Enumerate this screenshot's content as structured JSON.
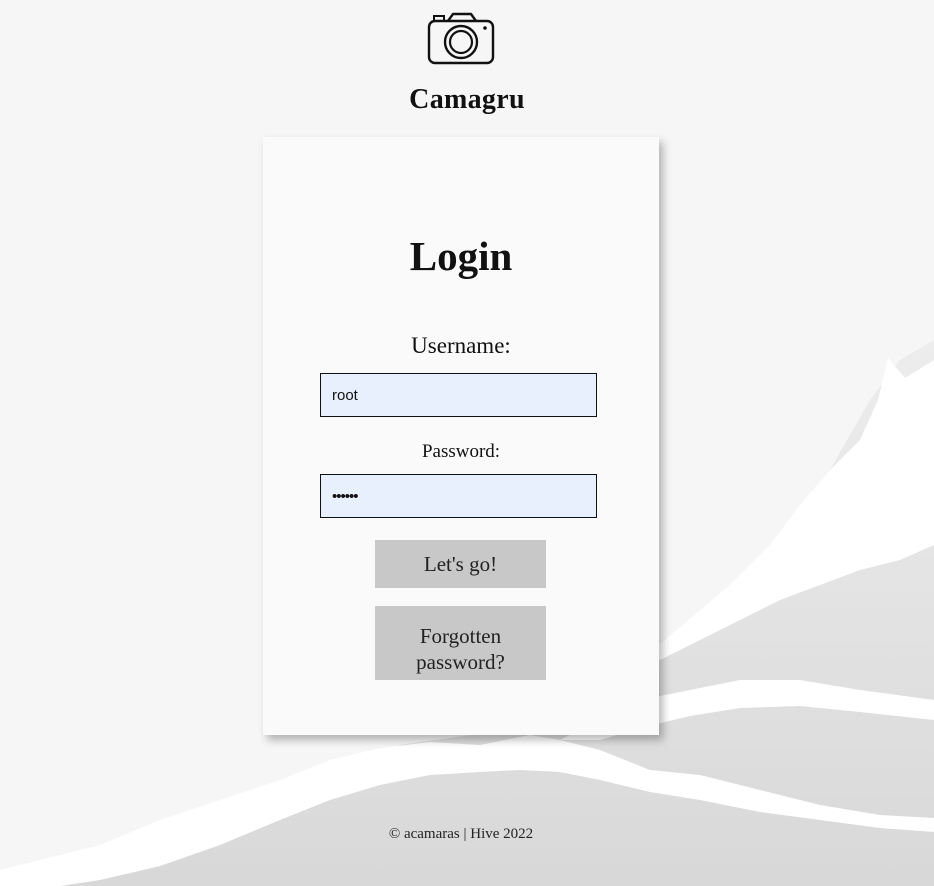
{
  "app": {
    "name": "Camagru",
    "logo_icon": "camera-icon"
  },
  "login": {
    "title": "Login",
    "username_label": "Username:",
    "username_value": "root",
    "password_label": "Password:",
    "password_value": "••••••",
    "submit_label": "Let's go!",
    "forgot_label": "Forgotten password?"
  },
  "footer": {
    "text": "© acamaras | Hive 2022"
  },
  "colors": {
    "page_background": "#f6f6f6",
    "card_background": "#fafafa",
    "input_background": "#e8f0fe",
    "button_background": "#c8c8c8"
  }
}
